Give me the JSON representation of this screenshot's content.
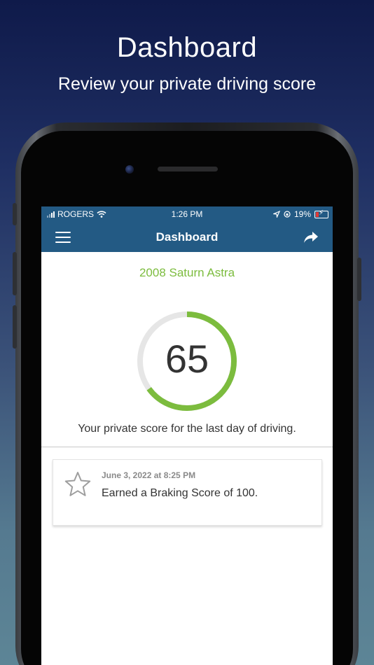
{
  "hero": {
    "title": "Dashboard",
    "subtitle": "Review your private driving score"
  },
  "status_bar": {
    "carrier": "ROGERS",
    "time": "1:26 PM",
    "battery": "19%",
    "battery_color": "#e53935"
  },
  "nav": {
    "title": "Dashboard",
    "menu_icon": "hamburger-menu-icon",
    "share_icon": "share-arrow-icon",
    "bar_color": "#235a84"
  },
  "vehicle": {
    "name": "2008 Saturn Astra",
    "color": "#7cbc3e"
  },
  "score": {
    "value": "65",
    "max": 100,
    "caption": "Your private score for the last day of driving."
  },
  "events": [
    {
      "icon": "star-outline-icon",
      "date": "June 3, 2022 at 8:25 PM",
      "text": "Earned a Braking Score of 100."
    }
  ]
}
